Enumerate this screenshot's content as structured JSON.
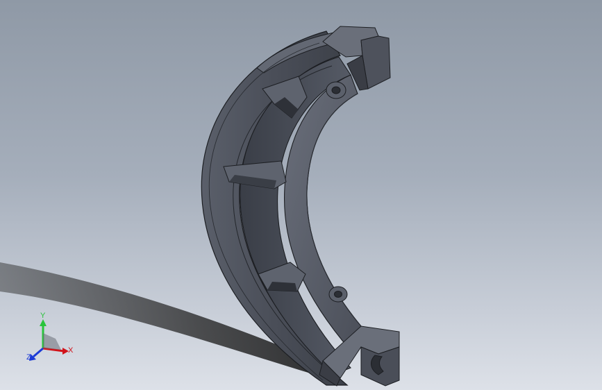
{
  "viewport": {
    "background_top": "#8f99a6",
    "background_bottom": "#dde1e8"
  },
  "part": {
    "icon": "brake-shoe-model",
    "body_color": "#4d525c",
    "face_color": "#5b606b",
    "edge_color": "#1c1e22"
  },
  "triad": {
    "x_label": "X",
    "y_label": "Y",
    "z_label": "Z",
    "x_color": "#d1131a",
    "y_color": "#29c43b",
    "z_color": "#1c3bd6"
  }
}
